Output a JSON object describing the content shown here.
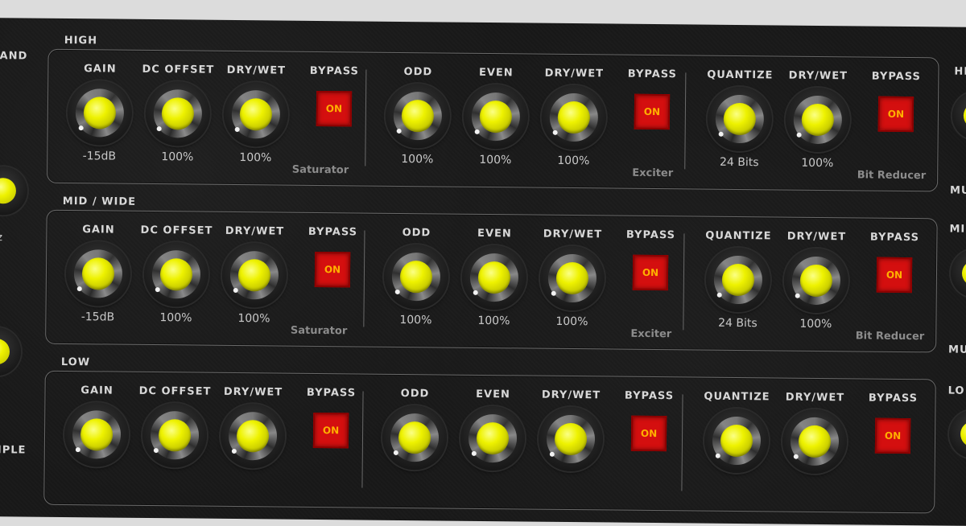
{
  "bands": [
    {
      "title": "HIGH",
      "saturator": {
        "name": "Saturator",
        "controls": [
          {
            "label": "GAIN",
            "value": "-15dB"
          },
          {
            "label": "DC OFFSET",
            "value": "100%"
          },
          {
            "label": "DRY/WET",
            "value": "100%"
          }
        ],
        "bypass_label": "BYPASS",
        "bypass_button": "ON"
      },
      "exciter": {
        "name": "Exciter",
        "controls": [
          {
            "label": "ODD",
            "value": "100%"
          },
          {
            "label": "EVEN",
            "value": "100%"
          },
          {
            "label": "DRY/WET",
            "value": "100%"
          }
        ],
        "bypass_label": "BYPASS",
        "bypass_button": "ON"
      },
      "bitreducer": {
        "name": "Bit Reducer",
        "controls": [
          {
            "label": "QUANTIZE",
            "value": "24 Bits"
          },
          {
            "label": "DRY/WET",
            "value": "100%"
          }
        ],
        "bypass_label": "BYPASS",
        "bypass_button": "ON"
      }
    },
    {
      "title": "MID / WIDE",
      "saturator": {
        "name": "Saturator",
        "controls": [
          {
            "label": "GAIN",
            "value": "-15dB"
          },
          {
            "label": "DC OFFSET",
            "value": "100%"
          },
          {
            "label": "DRY/WET",
            "value": "100%"
          }
        ],
        "bypass_label": "BYPASS",
        "bypass_button": "ON"
      },
      "exciter": {
        "name": "Exciter",
        "controls": [
          {
            "label": "ODD",
            "value": "100%"
          },
          {
            "label": "EVEN",
            "value": "100%"
          },
          {
            "label": "DRY/WET",
            "value": "100%"
          }
        ],
        "bypass_label": "BYPASS",
        "bypass_button": "ON"
      },
      "bitreducer": {
        "name": "Bit Reducer",
        "controls": [
          {
            "label": "QUANTIZE",
            "value": "24 Bits"
          },
          {
            "label": "DRY/WET",
            "value": "100%"
          }
        ],
        "bypass_label": "BYPASS",
        "bypass_button": "ON"
      }
    },
    {
      "title": "LOW",
      "saturator": {
        "name": "",
        "controls": [
          {
            "label": "GAIN",
            "value": ""
          },
          {
            "label": "DC OFFSET",
            "value": ""
          },
          {
            "label": "DRY/WET",
            "value": ""
          }
        ],
        "bypass_label": "BYPASS",
        "bypass_button": "ON"
      },
      "exciter": {
        "name": "",
        "controls": [
          {
            "label": "ODD",
            "value": ""
          },
          {
            "label": "EVEN",
            "value": ""
          },
          {
            "label": "DRY/WET",
            "value": ""
          }
        ],
        "bypass_label": "BYPASS",
        "bypass_button": "ON"
      },
      "bitreducer": {
        "name": "",
        "controls": [
          {
            "label": "QUANTIZE",
            "value": ""
          },
          {
            "label": "DRY/WET",
            "value": ""
          }
        ],
        "bypass_label": "BYPASS",
        "bypass_button": "ON"
      }
    }
  ],
  "left_fragments": [
    "AND",
    "Hz",
    "z",
    "MPLE"
  ],
  "right_fragments": [
    "HI",
    "MU",
    "MI",
    "MU",
    "LO"
  ],
  "colors": {
    "background": "#181818",
    "knob_cap": "#eef200",
    "bypass_on": "#d40f0f",
    "label": "#d8d8d8"
  }
}
